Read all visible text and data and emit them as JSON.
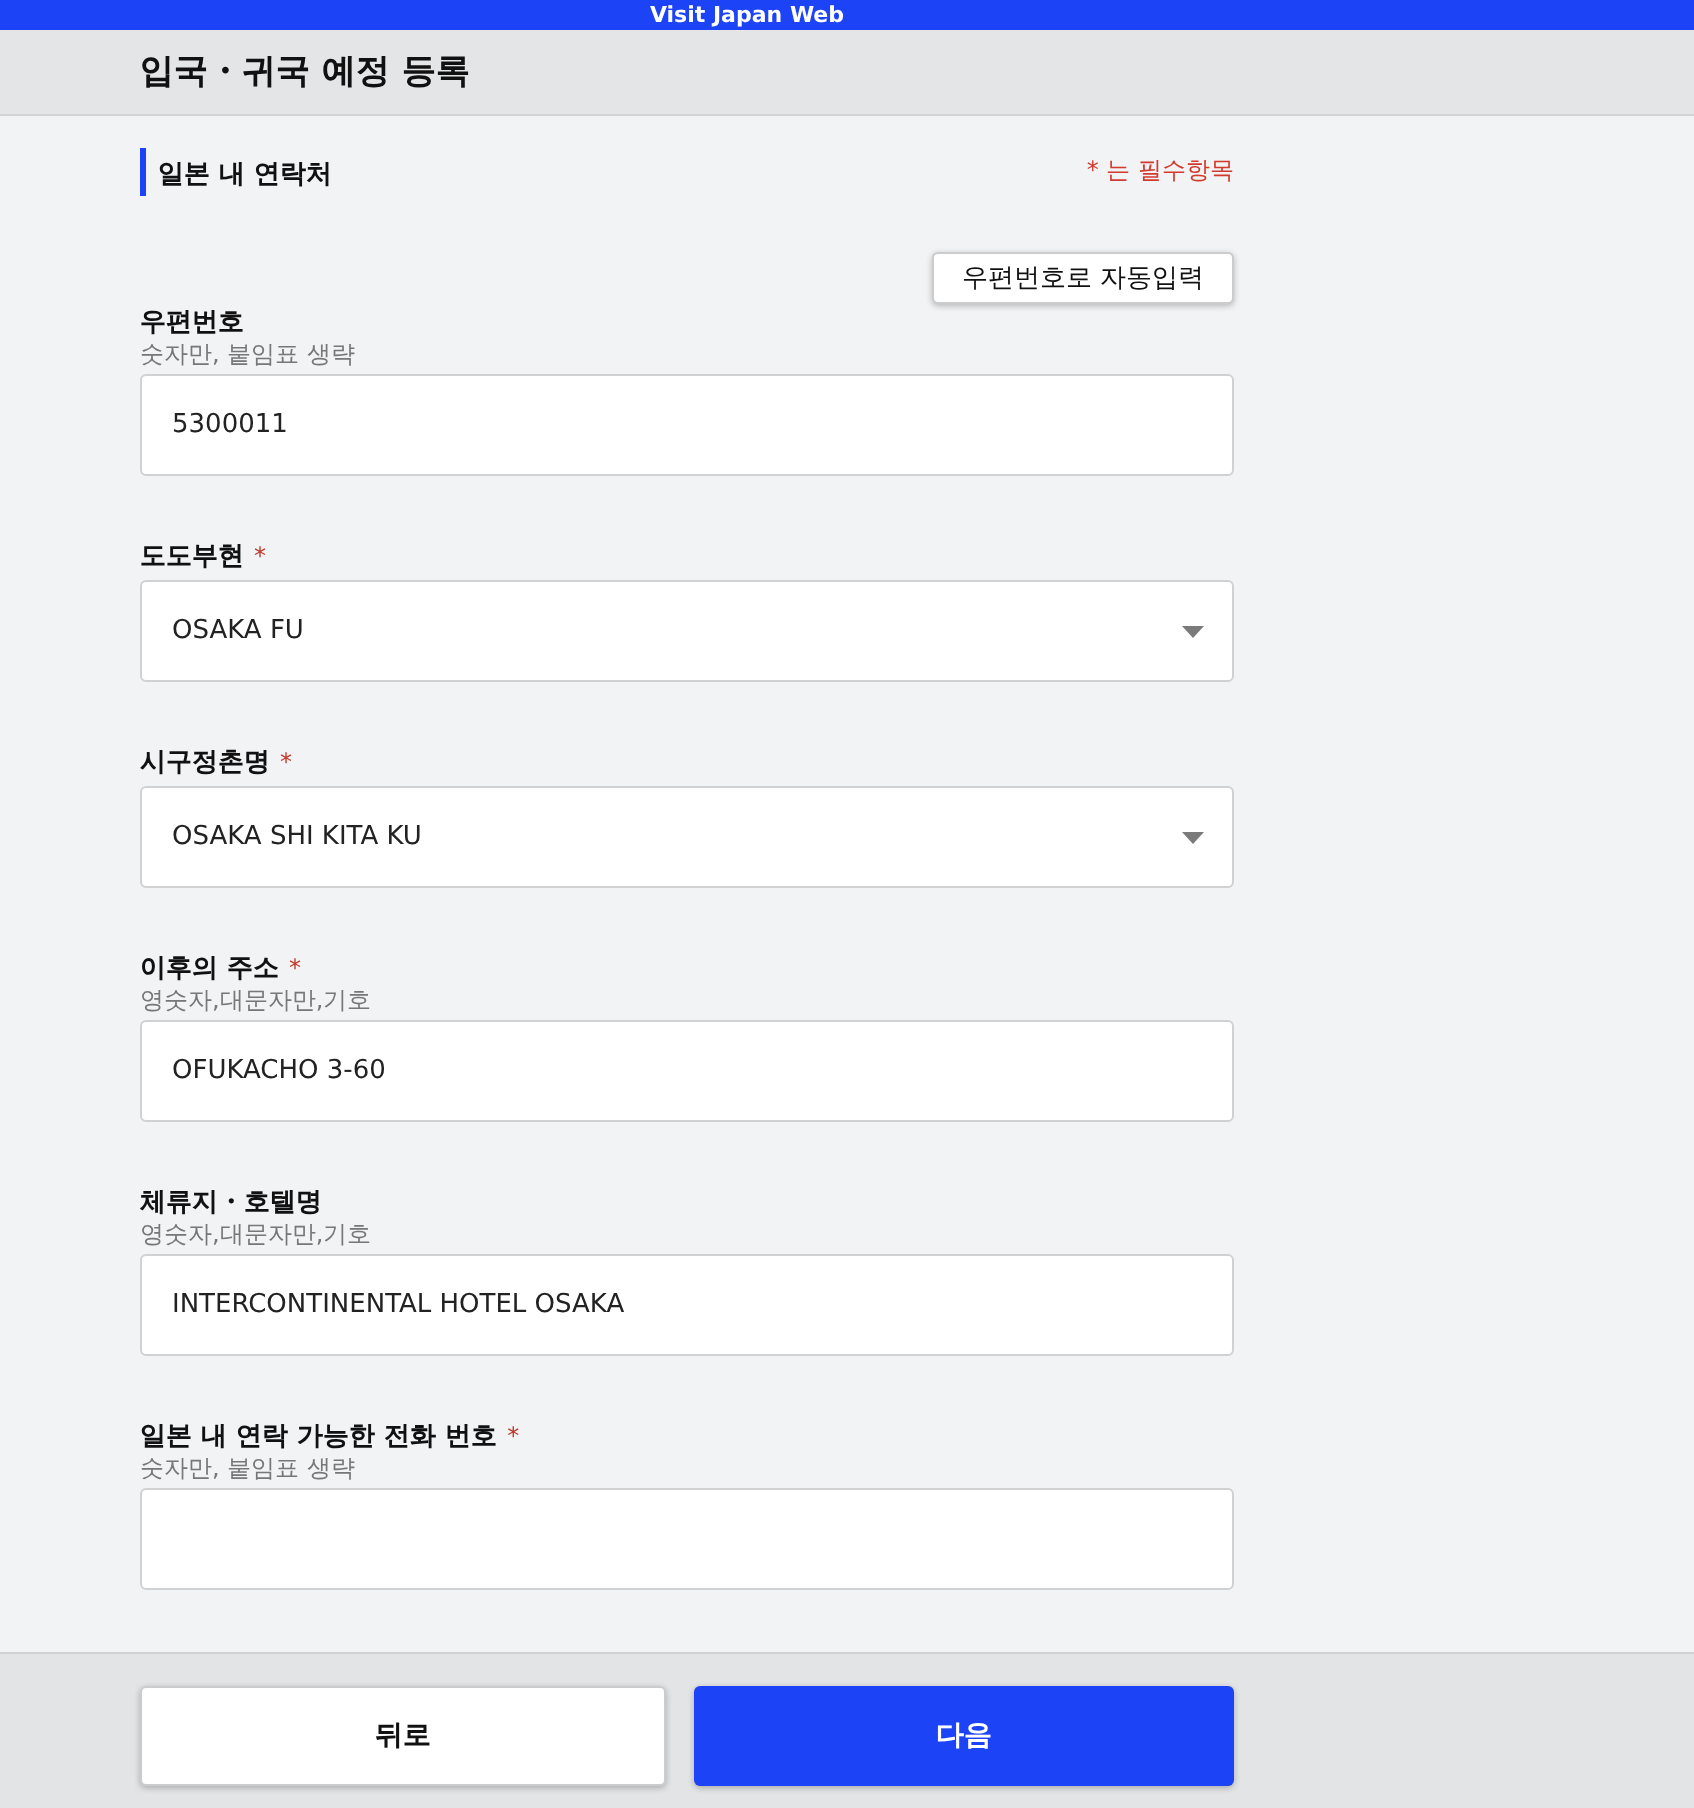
{
  "top_bar": {
    "title": "Visit Japan Web"
  },
  "header": {
    "title": "입국・귀국 예정 등록"
  },
  "section": {
    "title": "일본 내 연락처",
    "required_note": "* 는 필수항목",
    "autofill_button": "우편번호로 자동입력"
  },
  "fields": [
    {
      "kind": "text",
      "label": "우편번호",
      "hint": "숫자만, 붙임표 생략",
      "value": "5300011"
    },
    {
      "kind": "select",
      "label": "도도부현",
      "required_mark": "*",
      "value": "OSAKA FU"
    },
    {
      "kind": "select",
      "label": "시구정촌명",
      "required_mark": "*",
      "value": "OSAKA SHI KITA KU"
    },
    {
      "kind": "text",
      "label": "이후의 주소",
      "required_mark": "*",
      "hint": "영숫자,대문자만,기호",
      "value": "OFUKACHO 3-60"
    },
    {
      "kind": "text",
      "label": "체류지・호텔명",
      "hint": "영숫자,대문자만,기호",
      "value": "INTERCONTINENTAL HOTEL OSAKA"
    },
    {
      "kind": "text",
      "label": "일본 내 연락 가능한 전화 번호",
      "required_mark": "*",
      "hint": "숫자만, 붙임표 생략"
    }
  ],
  "footer": {
    "back_button": "뒤로",
    "next_button": "다음"
  }
}
